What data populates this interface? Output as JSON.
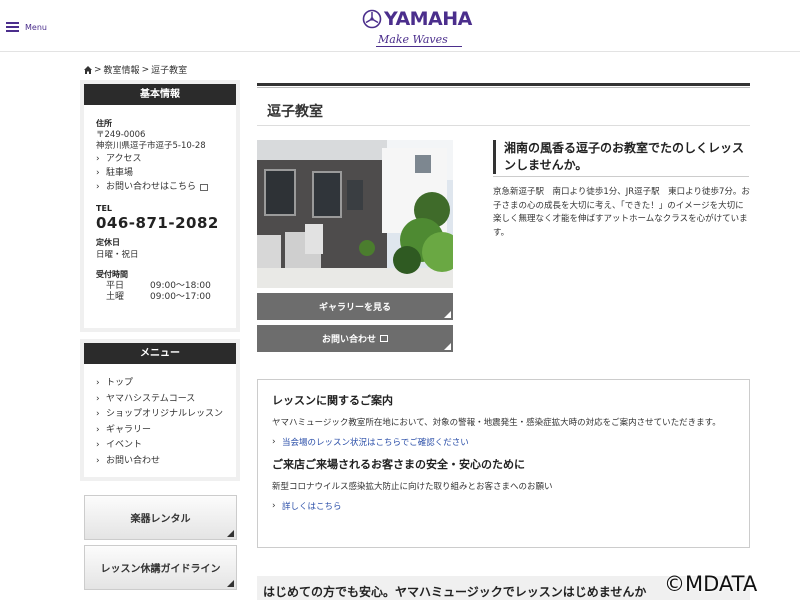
{
  "header": {
    "menu_label": "Menu",
    "logo_text": "YAMAHA",
    "logo_tagline": "Make Waves",
    "brand_color": "#4b2e8c"
  },
  "breadcrumb": {
    "items": [
      "教室情報",
      "逗子教室"
    ],
    "separator": ">",
    "home_icon": "home-icon"
  },
  "sidebar": {
    "basic": {
      "title": "基本情報",
      "address_label": "住所",
      "postal": "〒249-0006",
      "address": "神奈川県逗子市逗子5-10-28",
      "links": [
        "アクセス",
        "駐車場",
        "お問い合わせはこちら"
      ],
      "tel_label": "TEL",
      "tel": "046-871-2082",
      "closed_label": "定休日",
      "closed": "日曜・祝日",
      "hours_label": "受付時間",
      "hours": [
        {
          "day": "平日",
          "time": "09:00～18:00"
        },
        {
          "day": "土曜",
          "time": "09:00～17:00"
        }
      ]
    },
    "menu": {
      "title": "メニュー",
      "items": [
        "トップ",
        "ヤマハシステムコース",
        "ショップオリジナルレッスン",
        "ギャラリー",
        "イベント",
        "お問い合わせ"
      ]
    },
    "buttons": [
      "楽器レンタル",
      "レッスン休講ガイドライン"
    ]
  },
  "main": {
    "title": "逗子教室",
    "gallery_button": "ギャラリーを見る",
    "contact_button": "お問い合わせ",
    "catch": "湘南の風香る逗子のお教室でたのしくレッスンしませんか。",
    "description": "京急新逗子駅　南口より徒歩1分、JR逗子駅　東口より徒歩7分。お子さまの心の成長を大切に考え、「できた！」のイメージを大切に楽しく無理なく才能を伸ばすアットホームなクラスを心がけています。",
    "notice": {
      "heading1": "レッスンに関するご案内",
      "text1": "ヤマハミュージック教室所在地において、対象の警報・地震発生・感染症拡大時の対応をご案内させていただきます。",
      "link1": "当会場のレッスン状況はこちらでご確認ください",
      "heading2": "ご来店ご来場されるお客さまの安全・安心のために",
      "text2": "新型コロナウイルス感染拡大防止に向けた取り組みとお客さまへのお願い",
      "link2": "詳しくはこちら"
    },
    "bottom_heading": "はじめての方でも安心。ヤマハミュージックでレッスンはじめませんか"
  },
  "watermark": "©MDATA"
}
